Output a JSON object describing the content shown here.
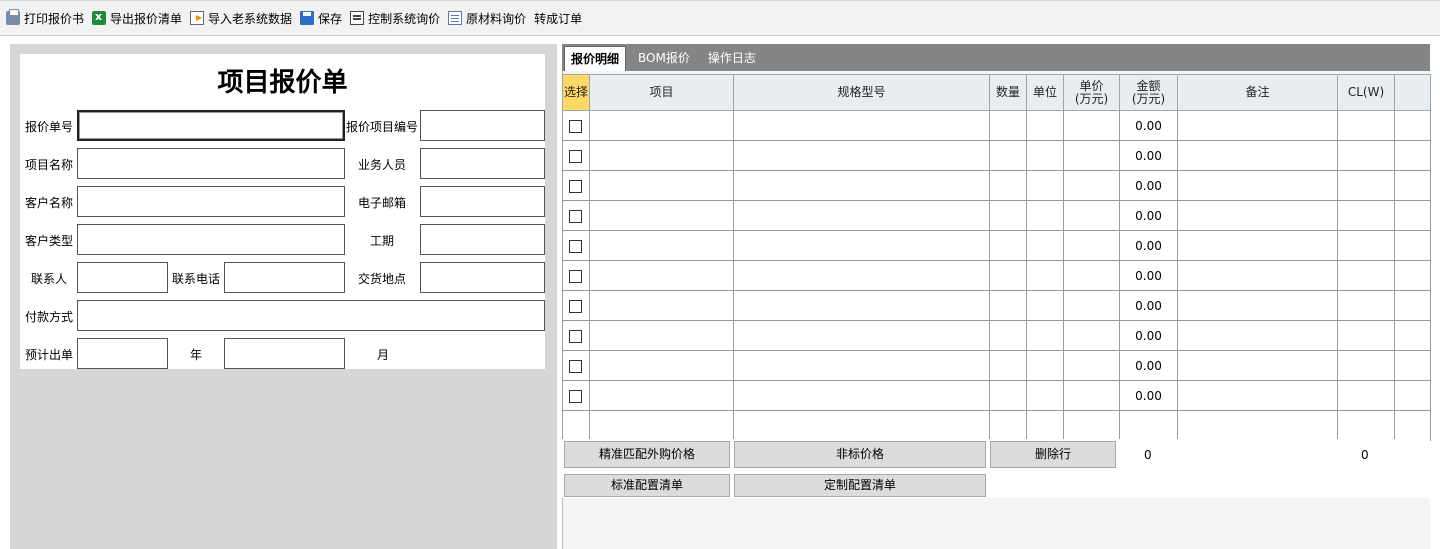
{
  "toolbar": {
    "items": [
      {
        "label": "打印报价书",
        "icon": "printer-icon"
      },
      {
        "label": "导出报价清单",
        "icon": "excel-icon"
      },
      {
        "label": "导入老系统数据",
        "icon": "import-icon"
      },
      {
        "label": "保存",
        "icon": "save-icon"
      },
      {
        "label": "控制系统询价",
        "icon": "control-icon"
      },
      {
        "label": "原材料询价",
        "icon": "material-icon"
      },
      {
        "label": "转成订单",
        "icon": ""
      }
    ]
  },
  "form": {
    "title": "项目报价单",
    "labels": {
      "quote_no": "报价单号",
      "quote_project_no": "报价项目编号",
      "project_name": "项目名称",
      "salesperson": "业务人员",
      "customer_name": "客户名称",
      "email": "电子邮箱",
      "customer_type": "客户类型",
      "duration": "工期",
      "contact": "联系人",
      "contact_phone": "联系电话",
      "delivery_place": "交货地点",
      "payment": "付款方式",
      "expected_order": "预计出单",
      "year": "年",
      "month": "月"
    },
    "values": {
      "quote_no": "",
      "quote_project_no": "",
      "project_name": "",
      "salesperson": "",
      "customer_name": "",
      "email": "",
      "customer_type": "",
      "duration": "",
      "contact": "",
      "contact_phone": "",
      "delivery_place": "",
      "payment": "",
      "year": "",
      "month": ""
    }
  },
  "tabs": [
    "报价明细",
    "BOM报价",
    "操作日志"
  ],
  "grid": {
    "headers": [
      "选择",
      "项目",
      "规格型号",
      "数量",
      "单位",
      "单价\n(万元)",
      "金额\n(万元)",
      "备注",
      "CL(W)",
      ""
    ],
    "amount_values": [
      "0.00",
      "0.00",
      "0.00",
      "0.00",
      "0.00",
      "0.00",
      "0.00",
      "0.00",
      "0.00",
      "0.00"
    ]
  },
  "buttons": {
    "match_price": "精准匹配外购价格",
    "nonstandard_price": "非标价格",
    "delete_row": "删除行",
    "standard_config": "标准配置清单",
    "custom_config": "定制配置清单"
  },
  "totals": {
    "left": "0",
    "right": "0"
  }
}
